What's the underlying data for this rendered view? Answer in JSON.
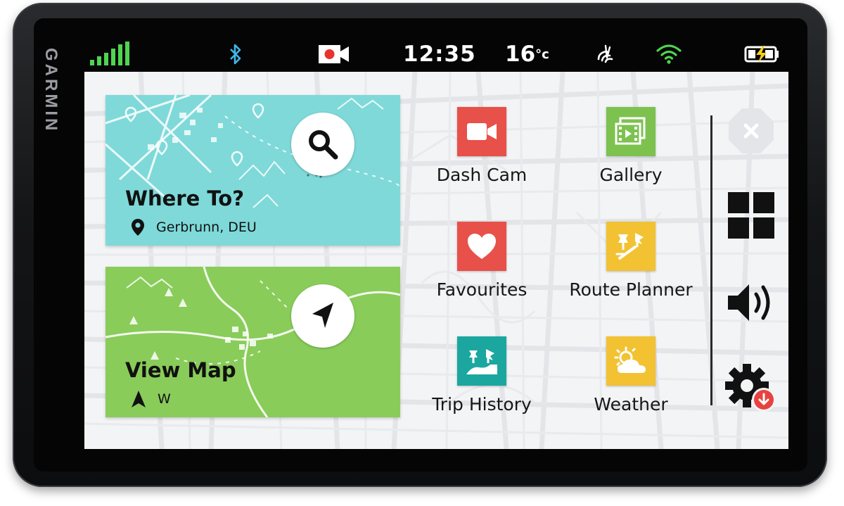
{
  "device": {
    "brand": "GARMIN"
  },
  "status": {
    "time": "12:35",
    "temperature": "16",
    "temperature_unit": "°c",
    "icons": [
      "signal-bars-icon",
      "bluetooth-icon",
      "dashcam-recording-icon",
      "traffic-icon",
      "wifi-icon",
      "battery-charging-icon"
    ],
    "colors": {
      "signal": "#4fd44f",
      "bluetooth": "#3fb8e8",
      "record": "#e8322f",
      "wifi": "#4fd44f",
      "charge": "#f3d11a"
    }
  },
  "cards": {
    "where_to": {
      "title": "Where To?",
      "location": "Gerbrunn, DEU",
      "color": "#7fd9d9"
    },
    "view_map": {
      "title": "View Map",
      "heading": "W",
      "color": "#89cc5a"
    }
  },
  "apps": [
    {
      "label": "Dash Cam",
      "icon": "video-camera-icon",
      "color": "#e8504a"
    },
    {
      "label": "Gallery",
      "icon": "gallery-icon",
      "color": "#7dc24f"
    },
    {
      "label": "Favourites",
      "icon": "heart-icon",
      "color": "#e8504a"
    },
    {
      "label": "Route Planner",
      "icon": "route-planner-icon",
      "color": "#f2c233"
    },
    {
      "label": "Trip History",
      "icon": "trip-history-icon",
      "color": "#1ba79f"
    },
    {
      "label": "Weather",
      "icon": "weather-icon",
      "color": "#f2c233"
    }
  ],
  "sidebar": {
    "buttons": [
      "close-icon",
      "apps-grid-icon",
      "volume-icon",
      "settings-update-icon"
    ],
    "update_badge_color": "#e8423f"
  }
}
